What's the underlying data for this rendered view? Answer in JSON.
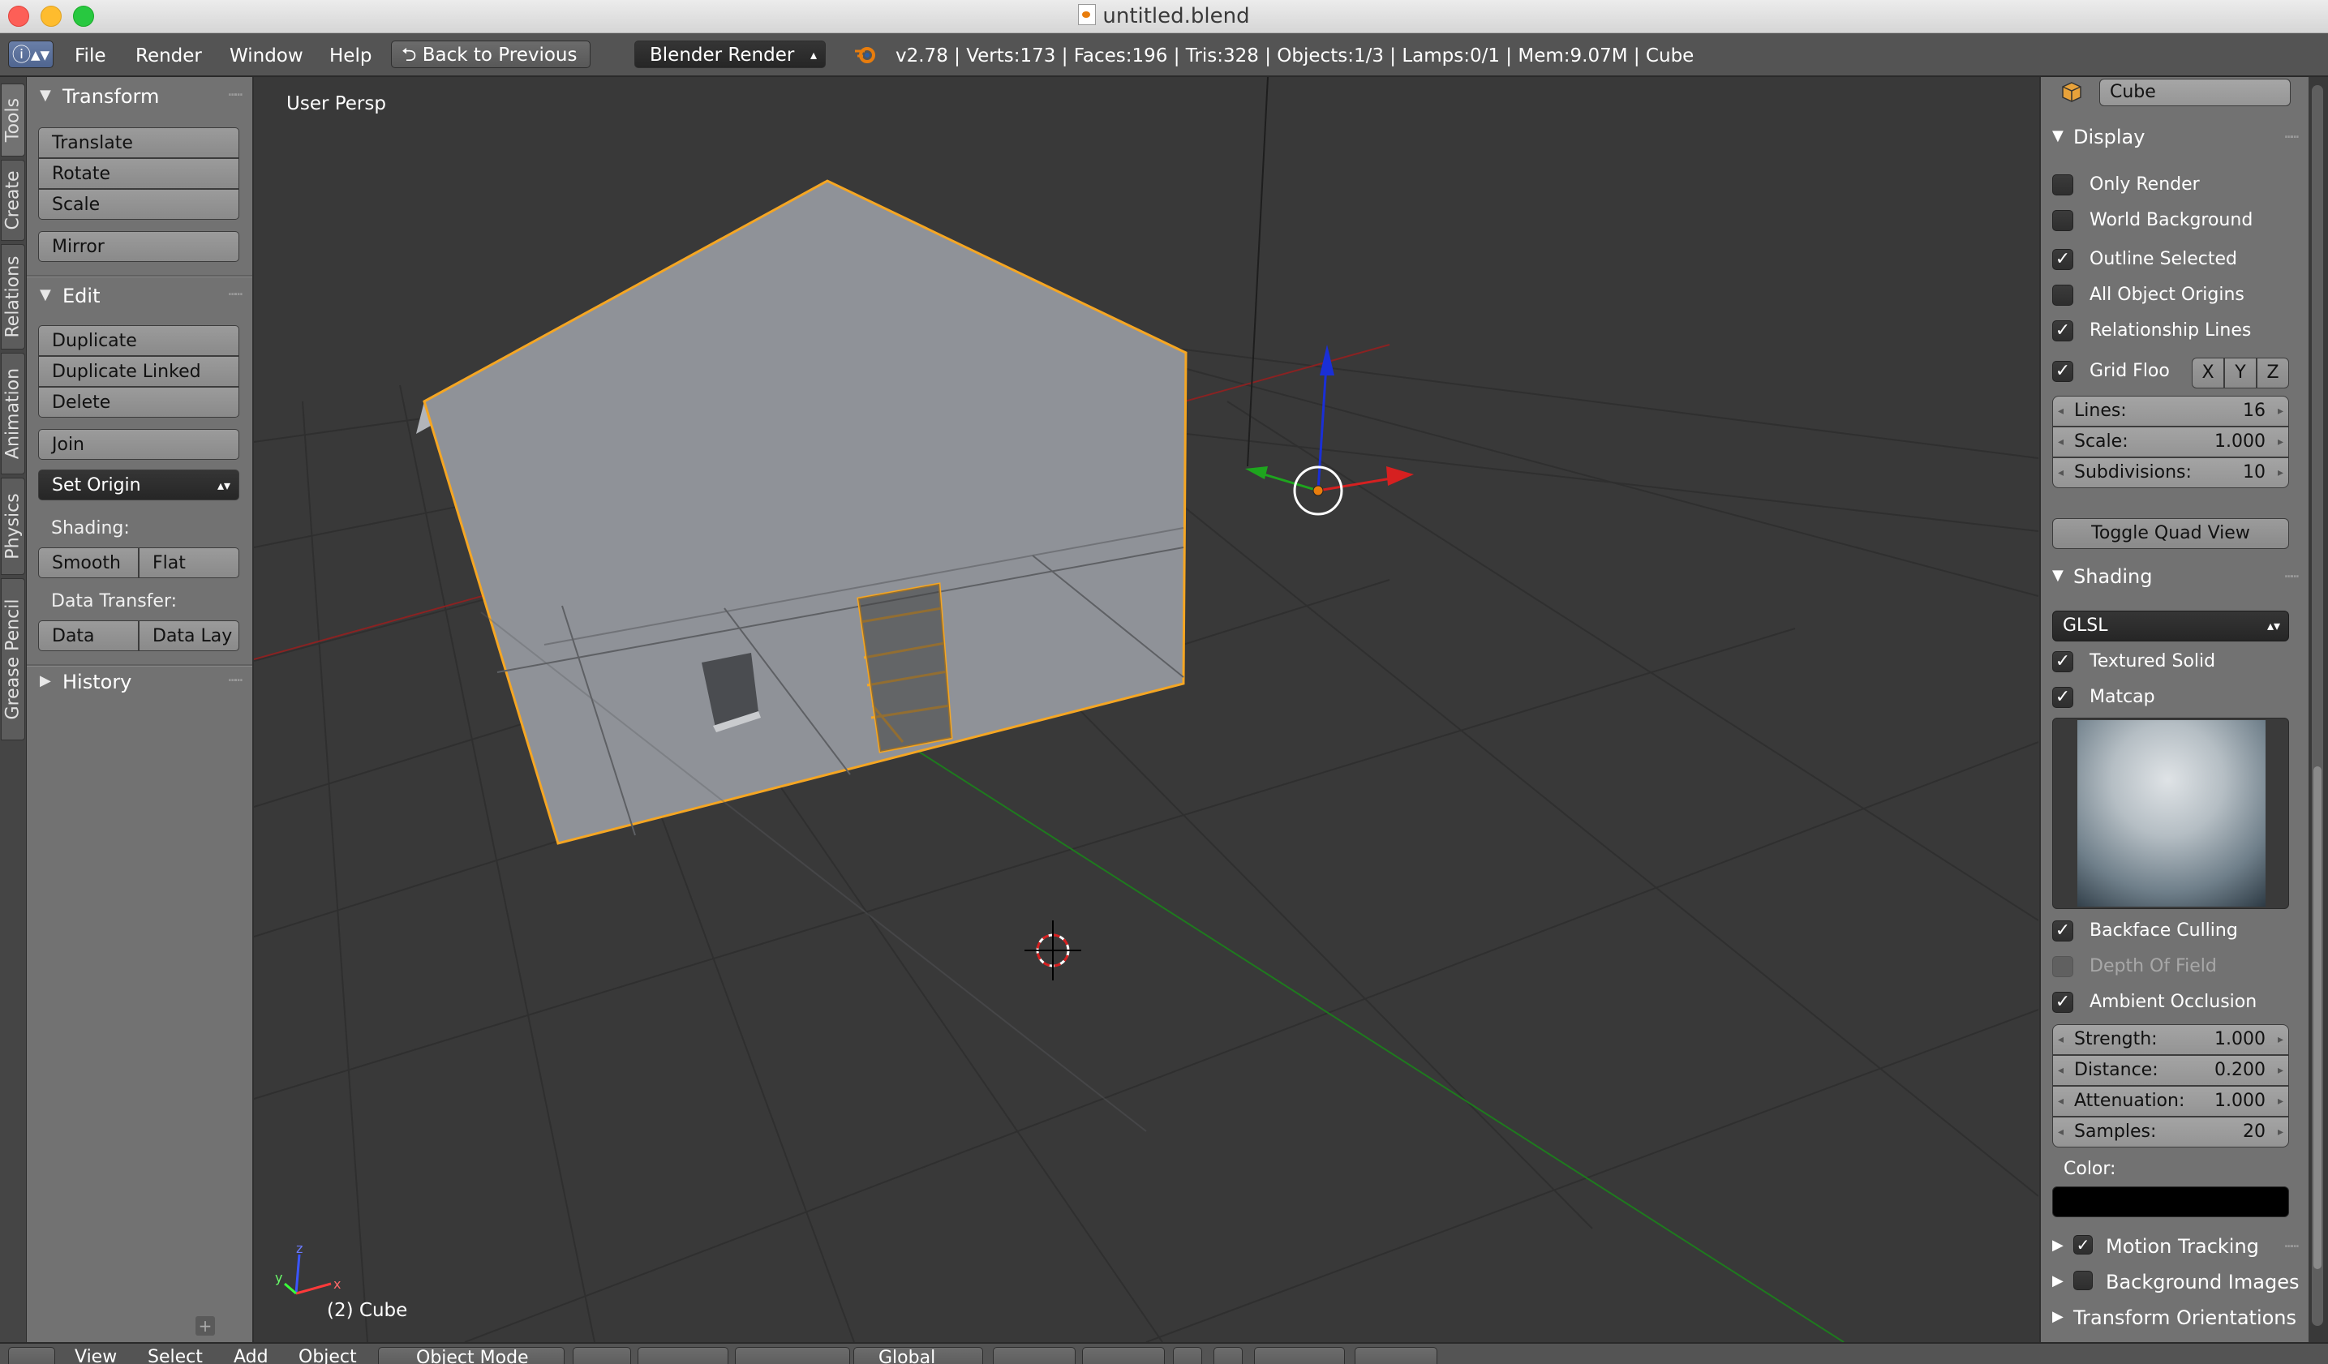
{
  "window": {
    "title": "untitled.blend"
  },
  "menu": {
    "file": "File",
    "render": "Render",
    "window": "Window",
    "help": "Help"
  },
  "info_header": {
    "back_button": "Back to Previous",
    "render_engine": "Blender Render",
    "stats": "v2.78 | Verts:173 | Faces:196 | Tris:328 | Objects:1/3 | Lamps:0/1 | Mem:9.07M | Cube"
  },
  "tool_tabs": [
    "Tools",
    "Create",
    "Relations",
    "Animation",
    "Physics",
    "Grease Pencil"
  ],
  "toolshelf": {
    "transform": {
      "title": "Transform",
      "translate": "Translate",
      "rotate": "Rotate",
      "scale": "Scale",
      "mirror": "Mirror"
    },
    "edit": {
      "title": "Edit",
      "duplicate": "Duplicate",
      "duplicate_linked": "Duplicate Linked",
      "delete": "Delete",
      "join": "Join",
      "set_origin": "Set Origin",
      "shading_label": "Shading:",
      "smooth": "Smooth",
      "flat": "Flat",
      "data_transfer_label": "Data Transfer:",
      "data": "Data",
      "data_lay": "Data Lay"
    },
    "history": {
      "title": "History"
    }
  },
  "viewport": {
    "view_label": "User Persp",
    "object_label": "(2) Cube"
  },
  "properties": {
    "object_name": "Cube",
    "display": {
      "title": "Display",
      "only_render": "Only Render",
      "only_render_checked": false,
      "world_background": "World Background",
      "world_background_checked": false,
      "outline_selected": "Outline Selected",
      "outline_selected_checked": true,
      "all_object_origins": "All Object Origins",
      "all_object_origins_checked": false,
      "relationship_lines": "Relationship Lines",
      "relationship_lines_checked": true,
      "grid_floor": "Grid Floo",
      "grid_floor_checked": true,
      "axis_x": "X",
      "axis_y": "Y",
      "axis_z": "Z",
      "lines_label": "Lines:",
      "lines_value": "16",
      "scale_label": "Scale:",
      "scale_value": "1.000",
      "subdivisions_label": "Subdivisions:",
      "subdivisions_value": "10",
      "toggle_quad_view": "Toggle Quad View"
    },
    "shading": {
      "title": "Shading",
      "mode": "GLSL",
      "textured_solid": "Textured Solid",
      "textured_solid_checked": true,
      "matcap": "Matcap",
      "matcap_checked": true,
      "backface_culling": "Backface Culling",
      "backface_culling_checked": true,
      "depth_of_field": "Depth Of Field",
      "depth_of_field_checked": false,
      "ambient_occlusion": "Ambient Occlusion",
      "ambient_occlusion_checked": true,
      "strength_label": "Strength:",
      "strength_value": "1.000",
      "distance_label": "Distance:",
      "distance_value": "0.200",
      "attenuation_label": "Attenuation:",
      "attenuation_value": "1.000",
      "samples_label": "Samples:",
      "samples_value": "20",
      "color_label": "Color:",
      "color_value": "#000000"
    },
    "motion_tracking": "Motion Tracking",
    "background_images": "Background Images",
    "transform_orientations": "Transform Orientations"
  },
  "bottom_header": {
    "view": "View",
    "select": "Select",
    "add": "Add",
    "object": "Object",
    "mode": "Object Mode",
    "orientation": "Global"
  },
  "colors": {
    "selection_outline": "#f5a623",
    "axis_x": "#d62020",
    "axis_y": "#1ea51e",
    "axis_z": "#1a2fd6",
    "panel_bg": "#727272",
    "viewport_bg": "#393939"
  }
}
